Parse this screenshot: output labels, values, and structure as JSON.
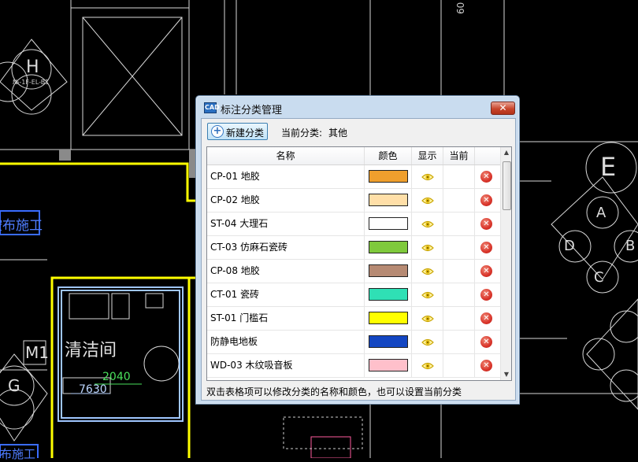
{
  "cad": {
    "labels": {
      "grid_h": "H",
      "grid_e": "E",
      "grid_a": "A",
      "grid_d": "D",
      "grid_b": "B",
      "grid_c": "C",
      "grid_g": "G",
      "grid_m1": "M1",
      "room_name": "清洁间",
      "dim_2040": "2040",
      "dim_7630": "7630",
      "dim_60": "60",
      "blue_tag_1": "按布施工",
      "blue_tag_2": "布施工",
      "tag_small": "№-1F-EL-B1"
    }
  },
  "dialog": {
    "title": "标注分类管理",
    "app_icon_text": "CAD",
    "close_glyph": "✕",
    "new_button_label": "新建分类",
    "current_category_label": "当前分类:",
    "current_category_value": "其他",
    "columns": [
      "名称",
      "颜色",
      "显示",
      "当前"
    ],
    "rows": [
      {
        "name": "CP-01 地胶",
        "color": "#ef9f2d"
      },
      {
        "name": "CP-02 地胶",
        "color": "#ffdfa8"
      },
      {
        "name": "ST-04 大理石",
        "color": "#ffffff"
      },
      {
        "name": "CT-03 仿麻石瓷砖",
        "color": "#7fc93c"
      },
      {
        "name": "CP-08 地胶",
        "color": "#b68a73"
      },
      {
        "name": "CT-01 瓷砖",
        "color": "#2fe0b5"
      },
      {
        "name": "ST-01 门槛石",
        "color": "#ffff00"
      },
      {
        "name": "防静电地板",
        "color": "#1346c2"
      },
      {
        "name": "WD-03 木纹吸音板",
        "color": "#ffc0cb"
      }
    ],
    "hint": "双击表格项可以修改分类的名称和颜色，也可以设置当前分类",
    "scroll_up_glyph": "▲",
    "scroll_down_glyph": "▼",
    "delete_glyph": "✕",
    "plus_glyph": "+"
  }
}
